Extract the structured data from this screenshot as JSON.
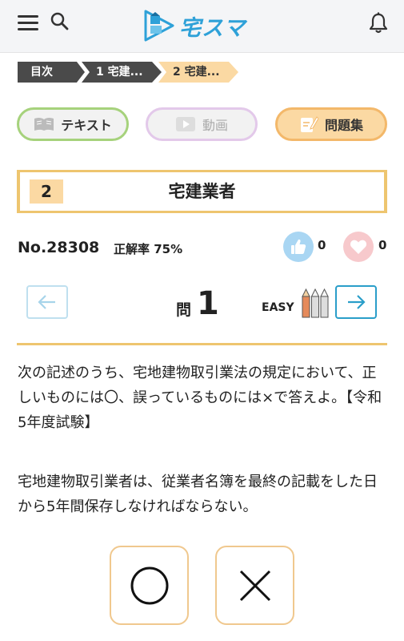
{
  "header": {
    "logo_text": "宅スマ",
    "brand_color": "#2ea1d8"
  },
  "breadcrumb": [
    {
      "label": "目次"
    },
    {
      "label": "1 宅建..."
    },
    {
      "label": "2 宅建..."
    }
  ],
  "tabs": [
    {
      "label": "テキスト",
      "icon": "book-icon",
      "active": false
    },
    {
      "label": "動画",
      "icon": "video-icon",
      "active": false,
      "disabled": true
    },
    {
      "label": "問題集",
      "icon": "notebook-pen-icon",
      "active": true
    }
  ],
  "section": {
    "number": "2",
    "title": "宅建業者"
  },
  "question_info": {
    "number": "No.28308",
    "correct_rate": "正解率 75%",
    "likes": "0",
    "favorites": "0"
  },
  "navigation": {
    "q_label": "問",
    "q_number": "1",
    "difficulty": "EASY",
    "difficulty_level_filled": 1,
    "difficulty_level_total": 3
  },
  "question": {
    "text": " 次の記述のうち、宅地建物取引業法の規定において、正しいものには〇、誤っているものには×で答えよ。【令和5年度試験】",
    "statement": "宅地建物取引業者は、従業者名簿を最終の記載をした日から5年間保存しなければならない。"
  },
  "answers": [
    {
      "label": "○",
      "icon": "circle-answer-icon"
    },
    {
      "label": "×",
      "icon": "cross-answer-icon"
    }
  ]
}
